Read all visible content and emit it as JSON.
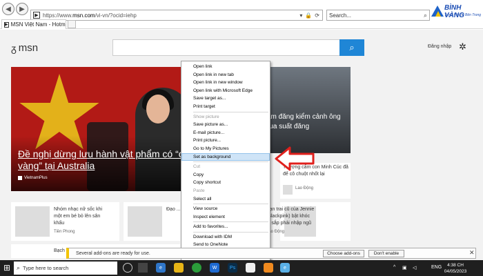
{
  "browser": {
    "url_prefix": "https://www.",
    "url_domain": "msn.com",
    "url_path": "/vi-vn/?ocid=iehp",
    "search_placeholder": "Search...",
    "tab_title": "MSN Việt Nam - Hotmail, ...",
    "back_icon": "back-icon",
    "forward_icon": "forward-icon"
  },
  "brand": {
    "name": "BÌNH VÀNG",
    "subtitle": "Tuyệt Vời Từ Bên Trong"
  },
  "msn": {
    "logo_text": "msn",
    "signin_label": "Đăng nhập",
    "hero": {
      "title": "Đề nghị dừng lưu hành vật phẩm có “cờ vàng” tại Australia",
      "source": "VietnamPlus"
    },
    "hero2": {
      "title": "câm đăng kiểm cảnh ông mua suất đăng"
    },
    "side_card": {
      "title": "Thượng cấm con Minh Cúc đã để cô chuột nhốt lại",
      "source": "Lao Động"
    },
    "row2": [
      {
        "title": "Nhóm nhạc nữ sốc khi một em bé bỏ lên sân khấu",
        "source": "Tiền Phong"
      },
      {
        "title": "Đạo ... Bình",
        "source": ""
      },
      {
        "title": "Bạn trai cũ của Jennie (Blackpink) bật khóc vì sắp phải nhập ngũ",
        "source": "Lao Động"
      }
    ],
    "row3": [
      {
        "title": "Bạch L..."
      }
    ]
  },
  "context_menu": {
    "items": [
      {
        "label": "Open link",
        "enabled": true
      },
      {
        "label": "Open link in new tab",
        "enabled": true
      },
      {
        "label": "Open link in new window",
        "enabled": true
      },
      {
        "label": "Open link with Microsoft Edge",
        "enabled": true
      },
      {
        "label": "Save target as...",
        "enabled": true
      },
      {
        "label": "Print target",
        "enabled": true
      },
      {
        "sep": true
      },
      {
        "label": "Show picture",
        "enabled": false
      },
      {
        "label": "Save picture as...",
        "enabled": true
      },
      {
        "label": "E-mail picture...",
        "enabled": true
      },
      {
        "label": "Print picture...",
        "enabled": true
      },
      {
        "label": "Go to My Pictures",
        "enabled": true
      },
      {
        "label": "Set as background",
        "enabled": true,
        "highlighted": true
      },
      {
        "sep": true
      },
      {
        "label": "Cut",
        "enabled": false
      },
      {
        "label": "Copy",
        "enabled": true
      },
      {
        "label": "Copy shortcut",
        "enabled": true
      },
      {
        "label": "Paste",
        "enabled": false
      },
      {
        "label": "Select all",
        "enabled": true
      },
      {
        "sep": true
      },
      {
        "label": "View source",
        "enabled": true
      },
      {
        "label": "Inspect element",
        "enabled": true
      },
      {
        "sep": true
      },
      {
        "label": "Add to favorites...",
        "enabled": true
      },
      {
        "sep": true
      },
      {
        "label": "Download with IDM",
        "enabled": true
      },
      {
        "label": "Send to OneNote",
        "enabled": true
      },
      {
        "sep": true
      },
      {
        "label": "Properties",
        "enabled": true
      }
    ]
  },
  "notification": {
    "message": "Several add-ons are ready for use.",
    "choose_label": "Choose add-ons",
    "dont_enable_label": "Don't enable"
  },
  "taskbar": {
    "search_placeholder": "Type here to search",
    "lang": "ENG",
    "time": "4:38 CH",
    "date": "04/05/2023"
  },
  "colors": {
    "accent": "#1f86d6",
    "arrow": "#e0201c",
    "highlight": "#cfe4f7",
    "notif_bar": "#f3c400"
  }
}
